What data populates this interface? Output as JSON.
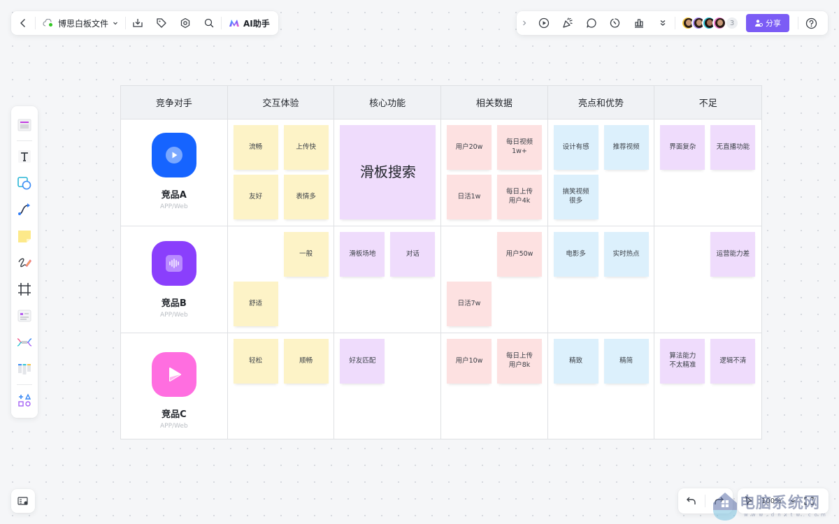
{
  "toolbar_left": {
    "back_icon": "chevron-left-icon",
    "file_title": "博思白板文件",
    "ai_label": "AI助手"
  },
  "toolbar_right": {
    "collaborator_extra_count": "3",
    "share_label": "分享"
  },
  "bottom_right": {
    "zoom_level": "100%"
  },
  "watermark": {
    "text": "电脑系统网",
    "url": "www.dnxtw.com"
  },
  "table": {
    "headers": [
      "竞争对手",
      "交互体验",
      "核心功能",
      "相关数据",
      "亮点和优势",
      "不足"
    ],
    "rows": [
      {
        "competitor": {
          "name": "竞品A",
          "platform": "APP/Web",
          "icon_color": "#1664ff"
        },
        "notes": {
          "interaction": [
            "流畅",
            "上传快",
            "友好",
            "表情多"
          ],
          "core": [
            "滑板搜索"
          ],
          "data": [
            "用户20w",
            "每日视频\n1w+",
            "日活1w",
            "每日上传\n用户4k"
          ],
          "highlights": [
            "设计有感",
            "推荐视频",
            "搞笑视频\n很多"
          ],
          "weakness": [
            "界面复杂",
            "无直播功能"
          ]
        }
      },
      {
        "competitor": {
          "name": "竞品B",
          "platform": "APP/Web",
          "icon_color": "#8a3ffc"
        },
        "notes": {
          "interaction": [
            "一般",
            "舒适"
          ],
          "core": [
            "滑板场地",
            "对话"
          ],
          "data": [
            "用户50w",
            "日活7w"
          ],
          "highlights": [
            "电影多",
            "实时热点"
          ],
          "weakness": [
            "运营能力差"
          ]
        }
      },
      {
        "competitor": {
          "name": "竞品C",
          "platform": "APP/Web",
          "icon_color": "#ff6ee0"
        },
        "notes": {
          "interaction": [
            "轻松",
            "顺畅"
          ],
          "core": [
            "好友匹配"
          ],
          "data": [
            "用户10w",
            "每日上传\n用户8k"
          ],
          "highlights": [
            "精致",
            "精简"
          ],
          "weakness": [
            "算法能力\n不太精准",
            "逻辑不清"
          ]
        }
      }
    ]
  },
  "colors": {
    "accent": "#7b5cf5",
    "note_yellow": "#fdf3c7",
    "note_purple": "#efdcfc",
    "note_pink": "#fde1e1",
    "note_blue": "#dcf0fc"
  }
}
